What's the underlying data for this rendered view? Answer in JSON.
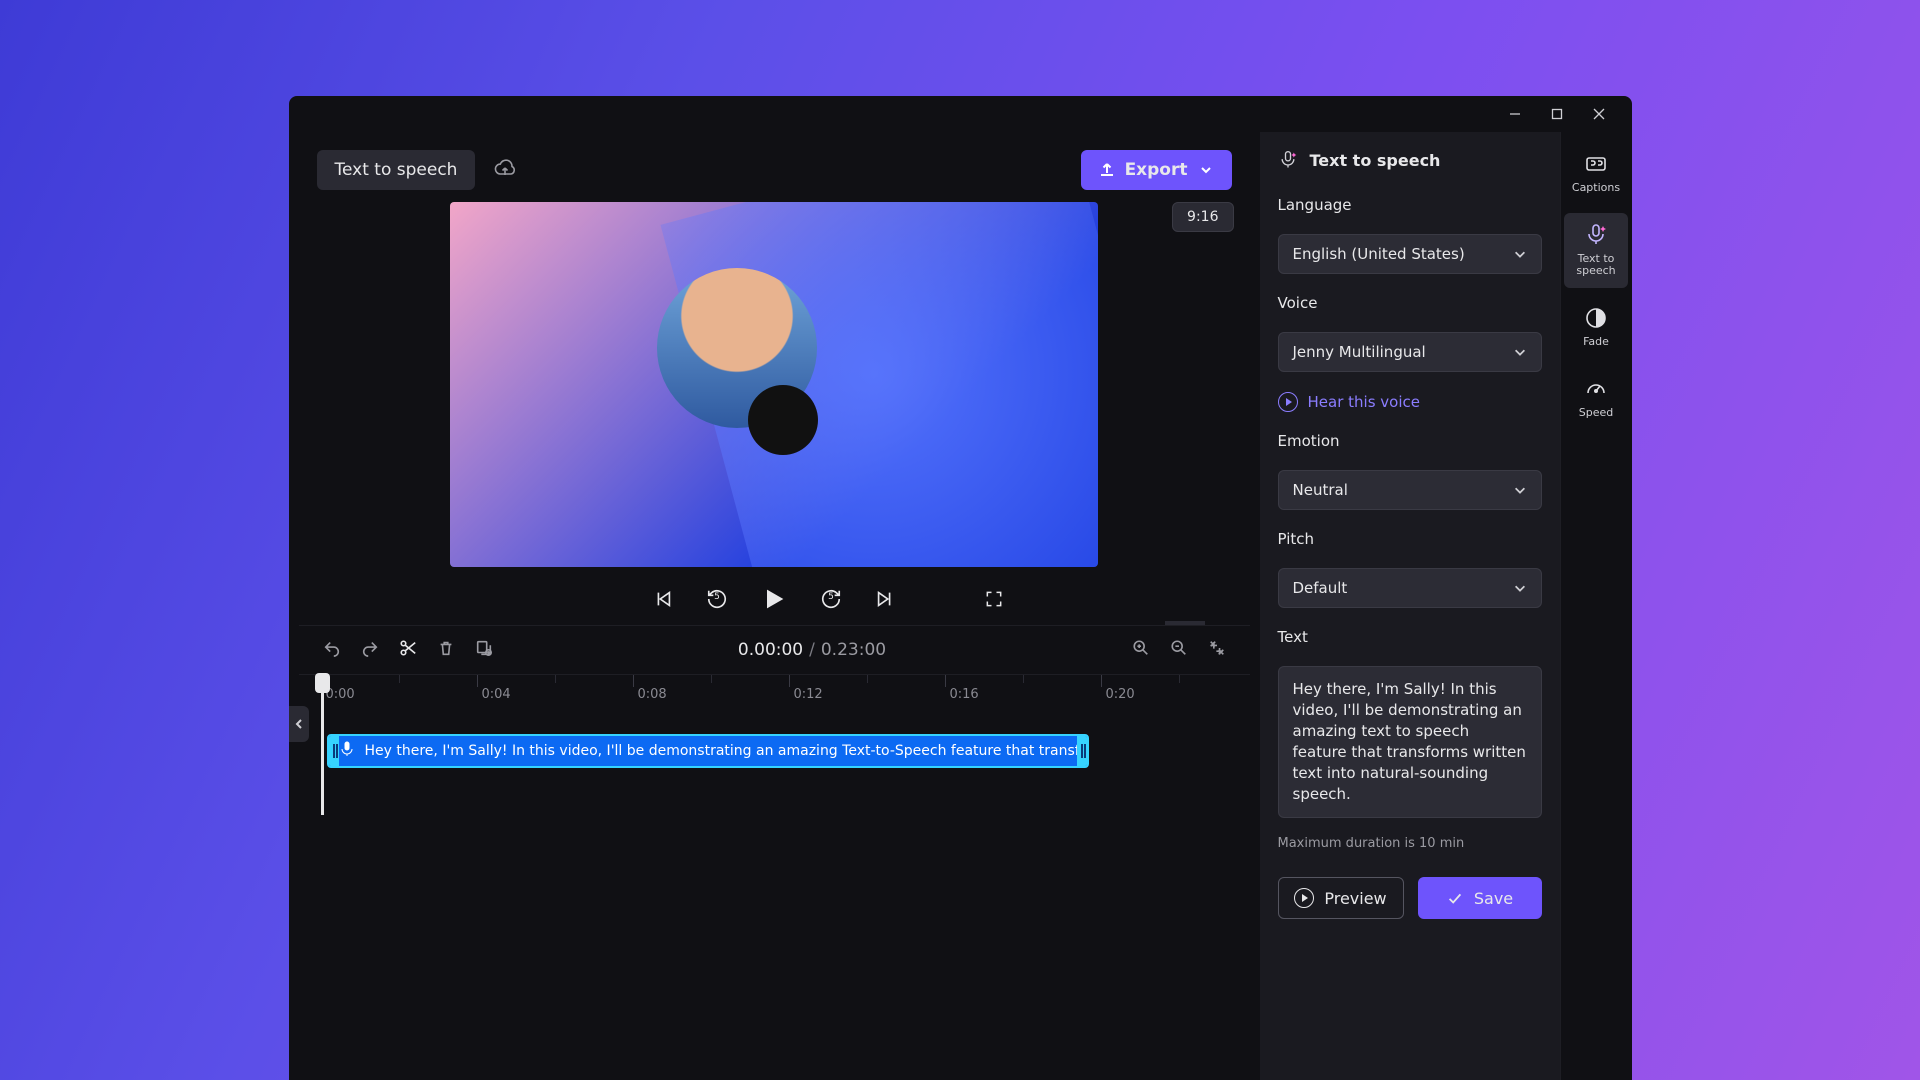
{
  "window": {
    "minimize": "minimize",
    "maximize": "maximize",
    "close": "close"
  },
  "header": {
    "title": "Text to speech",
    "export_label": "Export",
    "aspect_badge": "9:16"
  },
  "transport": {
    "current_time": "0.00:00",
    "total_time": "0.23:00",
    "jump_back_seconds": "5",
    "jump_fwd_seconds": "5"
  },
  "timeline": {
    "ticks": [
      "0:00",
      "0:04",
      "0:08",
      "0:12",
      "0:16",
      "0:20"
    ],
    "clip_text": "Hey there, I'm Sally! In this video, I'll be demonstrating an amazing Text-to-Speech feature that transforms w"
  },
  "panel": {
    "title": "Text to speech",
    "language_label": "Language",
    "language_value": "English (United States)",
    "voice_label": "Voice",
    "voice_value": "Jenny Multilingual",
    "hear_voice": "Hear this voice",
    "emotion_label": "Emotion",
    "emotion_value": "Neutral",
    "pitch_label": "Pitch",
    "pitch_value": "Default",
    "text_label": "Text",
    "text_value": "Hey there, I'm Sally! In this video, I'll be demonstrating an amazing text to speech feature that transforms written text into natural-sounding speech.",
    "hint": "Maximum duration is 10 min",
    "preview_btn": "Preview",
    "save_btn": "Save"
  },
  "rail": {
    "captions": "Captions",
    "tts": "Text to speech",
    "fade": "Fade",
    "speed": "Speed"
  }
}
